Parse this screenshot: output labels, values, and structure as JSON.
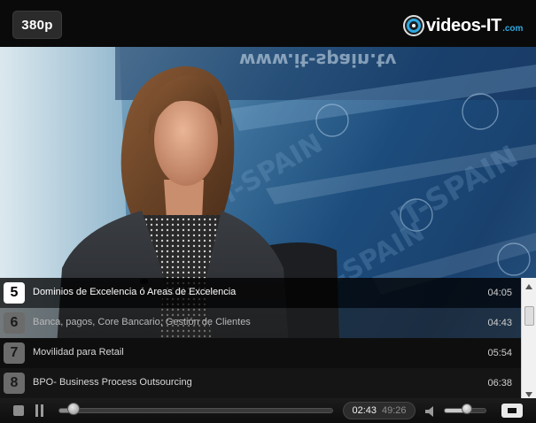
{
  "player": {
    "quality_label": "380p",
    "logo": {
      "name": "videos-IT",
      "suffix": ".com",
      "accent": "#2fa8e0"
    },
    "watermark": {
      "text": "IT-SPAIN",
      "badge": "tv",
      "url_mirrored": "www.it-spain.tv"
    }
  },
  "chapters": [
    {
      "number": "5",
      "title": "Dominios de Excelencia ó Areas de Excelencia",
      "time": "04:05",
      "state": "active"
    },
    {
      "number": "6",
      "title": "Banca, pagos, Core Bancario, Gestión de Clientes",
      "time": "04:43",
      "state": "normal"
    },
    {
      "number": "7",
      "title": "Movilidad para Retail",
      "time": "05:54",
      "state": "normal"
    },
    {
      "number": "8",
      "title": "BPO- Business Process Outsourcing",
      "time": "06:38",
      "state": "normal"
    }
  ],
  "playback": {
    "current_time": "02:43",
    "total_time": "49:26",
    "progress_fraction": 0.055,
    "volume_fraction": 0.55,
    "state": "playing"
  },
  "icons": {
    "stop": "stop-icon",
    "pause": "pause-icon",
    "volume": "speaker-icon",
    "fullscreen": "fullscreen-icon",
    "logo": "videos-it-logo-icon"
  }
}
